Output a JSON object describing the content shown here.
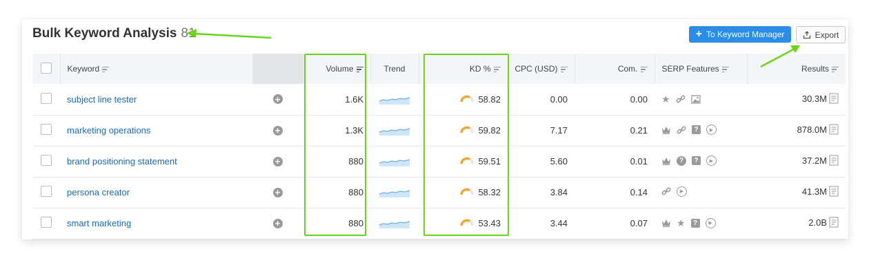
{
  "header": {
    "title": "Bulk Keyword Analysis",
    "count": "81"
  },
  "buttons": {
    "keyword_manager": "To Keyword Manager",
    "export": "Export"
  },
  "columns": {
    "keyword": "Keyword",
    "volume": "Volume",
    "trend": "Trend",
    "kd": "KD %",
    "cpc": "CPC (USD)",
    "com": "Com.",
    "serp": "SERP Features",
    "results": "Results"
  },
  "rows": [
    {
      "keyword": "subject line tester",
      "volume": "1.6K",
      "kd": "58.82",
      "cpc": "0.00",
      "com": "0.00",
      "serp": [
        "star",
        "link",
        "image"
      ],
      "results": "30.3M"
    },
    {
      "keyword": "marketing operations",
      "volume": "1.3K",
      "kd": "59.82",
      "cpc": "7.17",
      "com": "0.21",
      "serp": [
        "crown",
        "link",
        "faq",
        "video"
      ],
      "results": "878.0M"
    },
    {
      "keyword": "brand positioning statement",
      "volume": "880",
      "kd": "59.51",
      "cpc": "5.60",
      "com": "0.01",
      "serp": [
        "crown",
        "question",
        "faq",
        "video"
      ],
      "results": "37.2M"
    },
    {
      "keyword": "persona creator",
      "volume": "880",
      "kd": "58.32",
      "cpc": "3.84",
      "com": "0.14",
      "serp": [
        "link",
        "video"
      ],
      "results": "41.3M"
    },
    {
      "keyword": "smart marketing",
      "volume": "880",
      "kd": "53.43",
      "cpc": "3.44",
      "com": "0.07",
      "serp": [
        "crown",
        "star",
        "faq",
        "video"
      ],
      "results": "2.0B"
    }
  ],
  "colors": {
    "accent": "#2b8de8",
    "keyword_link": "#1a6bb0",
    "highlight": "#6ad419",
    "kd_gauge": "#f0a830"
  }
}
